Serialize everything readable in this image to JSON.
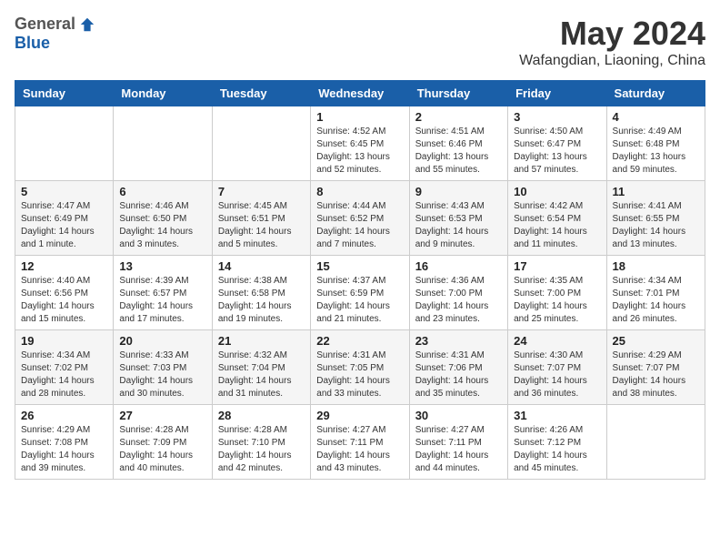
{
  "logo": {
    "general": "General",
    "blue": "Blue"
  },
  "title": "May 2024",
  "subtitle": "Wafangdian, Liaoning, China",
  "weekdays": [
    "Sunday",
    "Monday",
    "Tuesday",
    "Wednesday",
    "Thursday",
    "Friday",
    "Saturday"
  ],
  "weeks": [
    [
      {
        "day": "",
        "sunrise": "",
        "sunset": "",
        "daylight": ""
      },
      {
        "day": "",
        "sunrise": "",
        "sunset": "",
        "daylight": ""
      },
      {
        "day": "",
        "sunrise": "",
        "sunset": "",
        "daylight": ""
      },
      {
        "day": "1",
        "sunrise": "Sunrise: 4:52 AM",
        "sunset": "Sunset: 6:45 PM",
        "daylight": "Daylight: 13 hours and 52 minutes."
      },
      {
        "day": "2",
        "sunrise": "Sunrise: 4:51 AM",
        "sunset": "Sunset: 6:46 PM",
        "daylight": "Daylight: 13 hours and 55 minutes."
      },
      {
        "day": "3",
        "sunrise": "Sunrise: 4:50 AM",
        "sunset": "Sunset: 6:47 PM",
        "daylight": "Daylight: 13 hours and 57 minutes."
      },
      {
        "day": "4",
        "sunrise": "Sunrise: 4:49 AM",
        "sunset": "Sunset: 6:48 PM",
        "daylight": "Daylight: 13 hours and 59 minutes."
      }
    ],
    [
      {
        "day": "5",
        "sunrise": "Sunrise: 4:47 AM",
        "sunset": "Sunset: 6:49 PM",
        "daylight": "Daylight: 14 hours and 1 minute."
      },
      {
        "day": "6",
        "sunrise": "Sunrise: 4:46 AM",
        "sunset": "Sunset: 6:50 PM",
        "daylight": "Daylight: 14 hours and 3 minutes."
      },
      {
        "day": "7",
        "sunrise": "Sunrise: 4:45 AM",
        "sunset": "Sunset: 6:51 PM",
        "daylight": "Daylight: 14 hours and 5 minutes."
      },
      {
        "day": "8",
        "sunrise": "Sunrise: 4:44 AM",
        "sunset": "Sunset: 6:52 PM",
        "daylight": "Daylight: 14 hours and 7 minutes."
      },
      {
        "day": "9",
        "sunrise": "Sunrise: 4:43 AM",
        "sunset": "Sunset: 6:53 PM",
        "daylight": "Daylight: 14 hours and 9 minutes."
      },
      {
        "day": "10",
        "sunrise": "Sunrise: 4:42 AM",
        "sunset": "Sunset: 6:54 PM",
        "daylight": "Daylight: 14 hours and 11 minutes."
      },
      {
        "day": "11",
        "sunrise": "Sunrise: 4:41 AM",
        "sunset": "Sunset: 6:55 PM",
        "daylight": "Daylight: 14 hours and 13 minutes."
      }
    ],
    [
      {
        "day": "12",
        "sunrise": "Sunrise: 4:40 AM",
        "sunset": "Sunset: 6:56 PM",
        "daylight": "Daylight: 14 hours and 15 minutes."
      },
      {
        "day": "13",
        "sunrise": "Sunrise: 4:39 AM",
        "sunset": "Sunset: 6:57 PM",
        "daylight": "Daylight: 14 hours and 17 minutes."
      },
      {
        "day": "14",
        "sunrise": "Sunrise: 4:38 AM",
        "sunset": "Sunset: 6:58 PM",
        "daylight": "Daylight: 14 hours and 19 minutes."
      },
      {
        "day": "15",
        "sunrise": "Sunrise: 4:37 AM",
        "sunset": "Sunset: 6:59 PM",
        "daylight": "Daylight: 14 hours and 21 minutes."
      },
      {
        "day": "16",
        "sunrise": "Sunrise: 4:36 AM",
        "sunset": "Sunset: 7:00 PM",
        "daylight": "Daylight: 14 hours and 23 minutes."
      },
      {
        "day": "17",
        "sunrise": "Sunrise: 4:35 AM",
        "sunset": "Sunset: 7:00 PM",
        "daylight": "Daylight: 14 hours and 25 minutes."
      },
      {
        "day": "18",
        "sunrise": "Sunrise: 4:34 AM",
        "sunset": "Sunset: 7:01 PM",
        "daylight": "Daylight: 14 hours and 26 minutes."
      }
    ],
    [
      {
        "day": "19",
        "sunrise": "Sunrise: 4:34 AM",
        "sunset": "Sunset: 7:02 PM",
        "daylight": "Daylight: 14 hours and 28 minutes."
      },
      {
        "day": "20",
        "sunrise": "Sunrise: 4:33 AM",
        "sunset": "Sunset: 7:03 PM",
        "daylight": "Daylight: 14 hours and 30 minutes."
      },
      {
        "day": "21",
        "sunrise": "Sunrise: 4:32 AM",
        "sunset": "Sunset: 7:04 PM",
        "daylight": "Daylight: 14 hours and 31 minutes."
      },
      {
        "day": "22",
        "sunrise": "Sunrise: 4:31 AM",
        "sunset": "Sunset: 7:05 PM",
        "daylight": "Daylight: 14 hours and 33 minutes."
      },
      {
        "day": "23",
        "sunrise": "Sunrise: 4:31 AM",
        "sunset": "Sunset: 7:06 PM",
        "daylight": "Daylight: 14 hours and 35 minutes."
      },
      {
        "day": "24",
        "sunrise": "Sunrise: 4:30 AM",
        "sunset": "Sunset: 7:07 PM",
        "daylight": "Daylight: 14 hours and 36 minutes."
      },
      {
        "day": "25",
        "sunrise": "Sunrise: 4:29 AM",
        "sunset": "Sunset: 7:07 PM",
        "daylight": "Daylight: 14 hours and 38 minutes."
      }
    ],
    [
      {
        "day": "26",
        "sunrise": "Sunrise: 4:29 AM",
        "sunset": "Sunset: 7:08 PM",
        "daylight": "Daylight: 14 hours and 39 minutes."
      },
      {
        "day": "27",
        "sunrise": "Sunrise: 4:28 AM",
        "sunset": "Sunset: 7:09 PM",
        "daylight": "Daylight: 14 hours and 40 minutes."
      },
      {
        "day": "28",
        "sunrise": "Sunrise: 4:28 AM",
        "sunset": "Sunset: 7:10 PM",
        "daylight": "Daylight: 14 hours and 42 minutes."
      },
      {
        "day": "29",
        "sunrise": "Sunrise: 4:27 AM",
        "sunset": "Sunset: 7:11 PM",
        "daylight": "Daylight: 14 hours and 43 minutes."
      },
      {
        "day": "30",
        "sunrise": "Sunrise: 4:27 AM",
        "sunset": "Sunset: 7:11 PM",
        "daylight": "Daylight: 14 hours and 44 minutes."
      },
      {
        "day": "31",
        "sunrise": "Sunrise: 4:26 AM",
        "sunset": "Sunset: 7:12 PM",
        "daylight": "Daylight: 14 hours and 45 minutes."
      },
      {
        "day": "",
        "sunrise": "",
        "sunset": "",
        "daylight": ""
      }
    ]
  ]
}
